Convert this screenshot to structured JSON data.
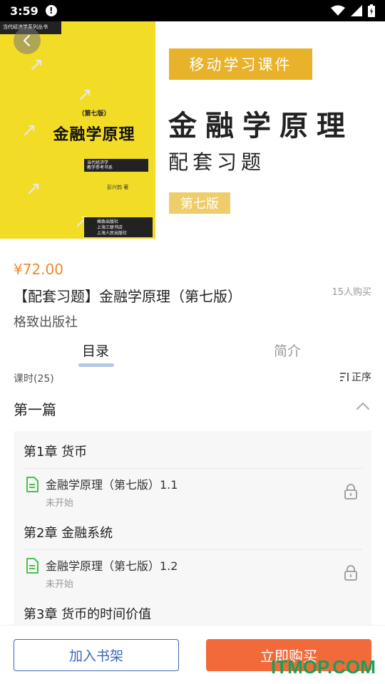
{
  "status_bar": {
    "time": "3:59",
    "alert_glyph": "!",
    "icons": [
      "alert-icon",
      "wifi-icon",
      "signal-icon",
      "battery-icon"
    ]
  },
  "banner": {
    "cover": {
      "series": "当代经济学系列丛书",
      "edition": "（第七版）",
      "title": "金融学原理",
      "plaque_line1": "当代经济学",
      "plaque_line2": "教学参考书系",
      "author": "彭兴韵 著",
      "publisher_line1": "格致出版社",
      "publisher_line2": "上海三联书店",
      "publisher_line3": "上海人民出版社"
    },
    "tag": "移动学习课件",
    "title": "金融学原理",
    "subtitle": "配套习题",
    "edition": "第七版"
  },
  "product": {
    "price": "¥72.00",
    "title": "【配套习题】金融学原理（第七版）",
    "buyers": "15人购买",
    "publisher": "格致出版社"
  },
  "tabs": [
    {
      "label": "目录",
      "active": true
    },
    {
      "label": "简介",
      "active": false
    }
  ],
  "catalog": {
    "lesson_count": "课时(25)",
    "sort_label": "正序",
    "section": {
      "title": "第一篇",
      "chapters": [
        {
          "title": "第1章 货币",
          "lessons": [
            {
              "name": "金融学原理（第七版）1.1",
              "status": "未开始",
              "locked": true
            }
          ]
        },
        {
          "title": "第2章 金融系统",
          "lessons": [
            {
              "name": "金融学原理（第七版）1.2",
              "status": "未开始",
              "locked": true
            }
          ]
        },
        {
          "title": "第3章 货币的时间价值",
          "lessons": []
        }
      ]
    }
  },
  "actions": {
    "add_to_shelf": "加入书架",
    "buy_now": "立即购买"
  },
  "watermark": "ITMOP.COM",
  "colors": {
    "price": "#f08a2c",
    "tag": "#e9b22b",
    "cover": "#f2dc25",
    "buy_button": "#f26a3a",
    "shelf_button": "#3b6ab5",
    "doc_icon": "#4cc04c"
  }
}
